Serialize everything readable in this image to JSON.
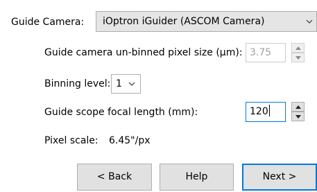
{
  "guide_camera": {
    "label": "Guide Camera:",
    "selected": "iOptron iGuider (ASCOM Camera)",
    "arrow_icon": "chevron-down-icon"
  },
  "pixel_size": {
    "label": "Guide camera un-binned pixel size (µm):",
    "value": "3.75",
    "enabled": false
  },
  "binning": {
    "label": "Binning level:",
    "selected": "1"
  },
  "focal_length": {
    "label": "Guide scope focal length (mm):",
    "value": "120"
  },
  "pixel_scale": {
    "label": "Pixel scale:",
    "value": "6.45\"/px"
  },
  "buttons": {
    "back": "< Back",
    "help": "Help",
    "next": "Next >"
  },
  "colors": {
    "focus_accent": "#0078d7",
    "button_face": "#e1e1e1",
    "combo_face": "#e5e5e5"
  }
}
